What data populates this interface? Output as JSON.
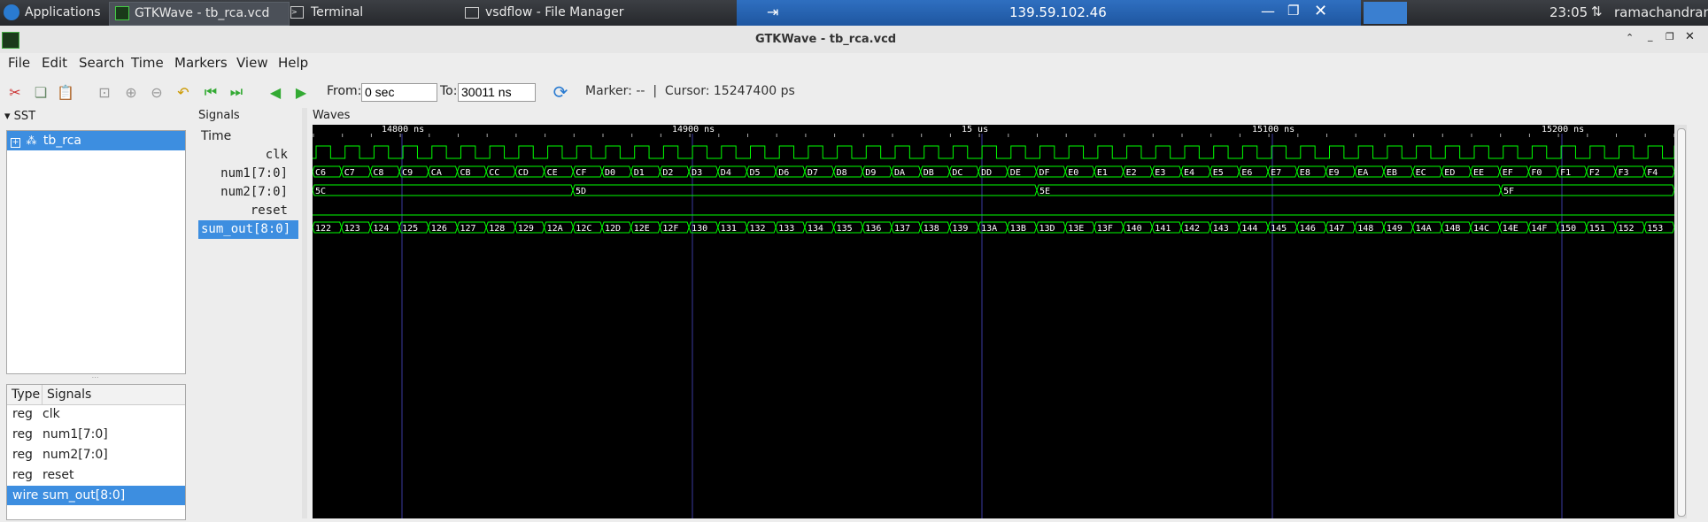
{
  "taskbar": {
    "applications_label": "Applications",
    "windows": [
      {
        "label": "GTKWave - tb_rca.vcd",
        "active": true
      },
      {
        "label": "Terminal",
        "active": false
      },
      {
        "label": "vsdflow - File Manager",
        "active": false
      }
    ],
    "remote_host": "139.59.102.46",
    "clock": "23:05",
    "user": "ramachandran"
  },
  "window": {
    "title": "GTKWave - tb_rca.vcd"
  },
  "menu": [
    "File",
    "Edit",
    "Search",
    "Time",
    "Markers",
    "View",
    "Help"
  ],
  "toolbar": {
    "from_label": "From:",
    "from_value": "0 sec",
    "to_label": "To:",
    "to_value": "30011 ns",
    "marker_text": "Marker: --  |  Cursor: 15247400 ps"
  },
  "sst": {
    "header": "SST",
    "tree_item": "tb_rca",
    "columns": [
      "Type",
      "Signals"
    ],
    "signals": [
      {
        "type": "reg",
        "name": "clk"
      },
      {
        "type": "reg",
        "name": "num1[7:0]"
      },
      {
        "type": "reg",
        "name": "num2[7:0]"
      },
      {
        "type": "reg",
        "name": "reset"
      },
      {
        "type": "wire",
        "name": "sum_out[8:0]",
        "selected": true
      }
    ]
  },
  "signals_pane": {
    "header": "Signals",
    "time_label": "Time",
    "names": [
      "clk",
      "num1[7:0]",
      "num2[7:0]",
      "reset",
      "sum_out[8:0]"
    ]
  },
  "waves": {
    "header": "Waves",
    "time_labels": [
      "14800 ns",
      "14900 ns",
      "15 us",
      "15100 ns",
      "15200 ns"
    ],
    "num1_values": [
      "C6",
      "C7",
      "C8",
      "C9",
      "CA",
      "CB",
      "CC",
      "CD",
      "CE",
      "CF",
      "D0",
      "D1",
      "D2",
      "D3",
      "D4",
      "D5",
      "D6",
      "D7",
      "D8",
      "D9",
      "DA",
      "DB",
      "DC",
      "DD",
      "DE",
      "DF",
      "E0",
      "E1",
      "E2",
      "E3",
      "E4",
      "E5",
      "E6",
      "E7",
      "E8",
      "E9",
      "EA",
      "EB",
      "EC",
      "ED",
      "EE",
      "EF",
      "F0",
      "F1",
      "F2",
      "F3",
      "F4"
    ],
    "num2_values": [
      "5C",
      "5D",
      "5E",
      "5F"
    ],
    "sum_values": [
      "122",
      "123",
      "124",
      "125",
      "126",
      "127",
      "128",
      "129",
      "12A",
      "12C",
      "12D",
      "12E",
      "12F",
      "130",
      "131",
      "132",
      "133",
      "134",
      "135",
      "136",
      "137",
      "138",
      "139",
      "13A",
      "13B",
      "13D",
      "13E",
      "13F",
      "140",
      "141",
      "142",
      "143",
      "144",
      "145",
      "146",
      "147",
      "148",
      "149",
      "14A",
      "14B",
      "14C",
      "14E",
      "14F",
      "150",
      "151",
      "152",
      "153"
    ],
    "trace_color": "#00ff00"
  }
}
